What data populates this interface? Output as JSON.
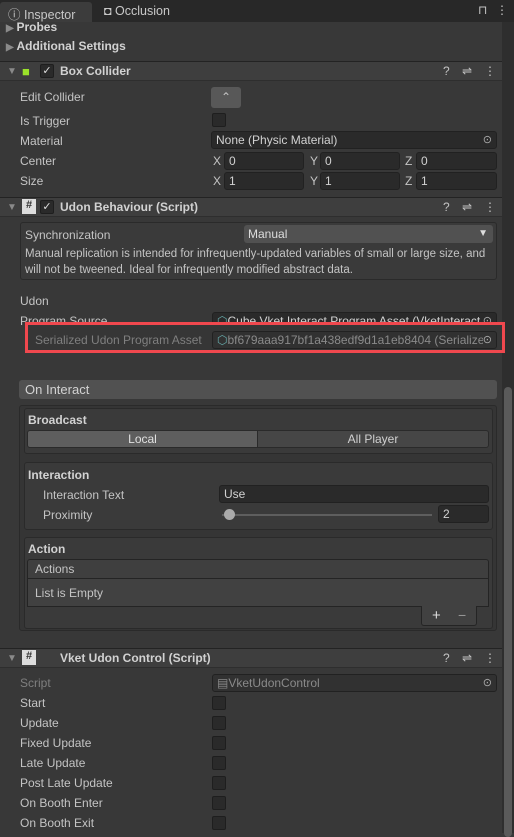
{
  "tabs": [
    {
      "label": "Inspector",
      "icon": "info-icon"
    },
    {
      "label": "Occlusion",
      "icon": "occlusion-icon"
    }
  ],
  "sections_top": {
    "probes": "Probes",
    "additional": "Additional Settings"
  },
  "box_collider": {
    "title": "Box Collider",
    "enabled": true,
    "edit_collider": "Edit Collider",
    "is_trigger": "Is Trigger",
    "material": "Material",
    "material_value": "None (Physic Material)",
    "center": "Center",
    "size": "Size",
    "center_values": {
      "x": "0",
      "y": "0",
      "z": "0"
    },
    "size_values": {
      "x": "1",
      "y": "1",
      "z": "1"
    },
    "axes": {
      "x": "X",
      "y": "Y",
      "z": "Z"
    }
  },
  "udon_behaviour": {
    "title": "Udon Behaviour (Script)",
    "enabled": true,
    "sync_label": "Synchronization",
    "sync_value": "Manual",
    "sync_help": "Manual replication is intended for infrequently-updated variables of small or large size, and will not be tweened. Ideal for infrequently modified abstract data.",
    "udon": "Udon",
    "program_source": "Program Source",
    "program_source_value": "Cube Vket Interact Program Asset (VketInteract",
    "serialized_label": "Serialized Udon Program Asset",
    "serialized_value": "bf679aaa917bf1a438edf9d1a1eb8404 (Serialized",
    "highlight_color": "#f0484e"
  },
  "on_interact": {
    "title": "On Interact",
    "broadcast": "Broadcast",
    "local": "Local",
    "all_player": "All Player",
    "interaction": "Interaction",
    "interaction_text": "Interaction Text",
    "interaction_text_value": "Use",
    "proximity": "Proximity",
    "proximity_value": "2",
    "action": "Action",
    "actions": "Actions",
    "empty": "List is Empty",
    "add": "+",
    "remove": "−"
  },
  "vket": {
    "title": "Vket Udon Control (Script)",
    "script": "Script",
    "script_value": "VketUdonControl",
    "items": [
      "Start",
      "Update",
      "Fixed Update",
      "Late Update",
      "Post Late Update",
      "On Booth Enter",
      "On Booth Exit"
    ]
  }
}
